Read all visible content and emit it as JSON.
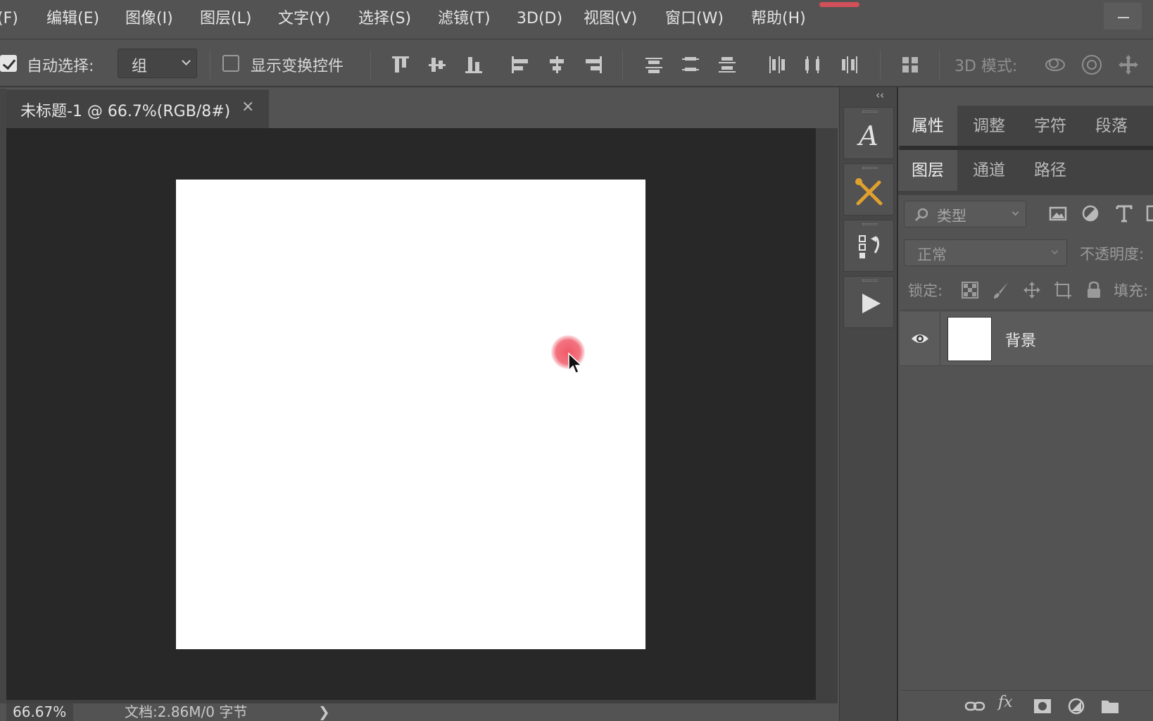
{
  "menu": {
    "items": [
      "(F)",
      "编辑(E)",
      "图像(I)",
      "图层(L)",
      "文字(Y)",
      "选择(S)",
      "滤镜(T)",
      "3D(D)",
      "视图(V)",
      "窗口(W)",
      "帮助(H)"
    ]
  },
  "options": {
    "auto_select_label": "自动选择:",
    "auto_select_checked": true,
    "auto_select_value": "组",
    "show_transform_label": "显示变换控件",
    "show_transform_checked": false,
    "mode3d_label": "3D 模式:"
  },
  "document": {
    "tab_title": "未标题-1 @ 66.7%(RGB/8#)",
    "close_glyph": "×",
    "canvas_color": "#ffffff",
    "zoom": "66.67%",
    "doc_info": "文档:2.86M/0 字节",
    "status_arrow": "❯"
  },
  "dock": {
    "collapse_glyph": "‹‹",
    "buttons": [
      "character-style",
      "tools-preset",
      "history",
      "actions"
    ]
  },
  "panels": {
    "top_tabs": [
      "属性",
      "调整",
      "字符",
      "段落"
    ],
    "layer_tabs": [
      "图层",
      "通道",
      "路径"
    ],
    "kind_label": "类型",
    "blend_mode": "正常",
    "opacity_label": "不透明度:",
    "lock_label": "锁定:",
    "fill_label": "填充:",
    "layers": [
      {
        "name": "背景",
        "visible": true
      }
    ],
    "footer_fx": "fx"
  },
  "colors": {
    "accent_red": "#d2505a",
    "cursor_halo": "#f0505f",
    "dock_orange": "#e0a030"
  }
}
